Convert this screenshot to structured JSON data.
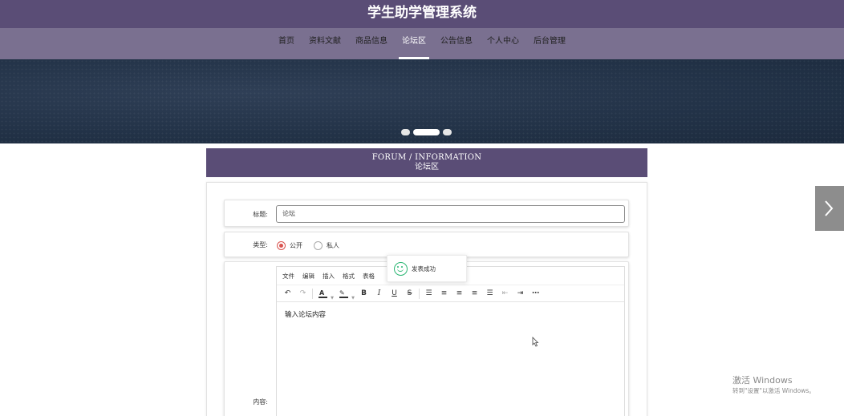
{
  "header": {
    "title": "学生助学管理系统"
  },
  "nav": {
    "items": [
      "首页",
      "资料文献",
      "商品信息",
      "论坛区",
      "公告信息",
      "个人中心",
      "后台管理"
    ],
    "active_index": 3
  },
  "banner": {
    "slides": 3,
    "active_slide": 1
  },
  "section": {
    "title_en": "FORUM / INFORMATION",
    "title_cn": "论坛区"
  },
  "form": {
    "title_label": "标题:",
    "title_value": "论坛",
    "type_label": "类型:",
    "type_options": [
      "公开",
      "私人"
    ],
    "type_selected": "公开",
    "content_label": "内容:"
  },
  "editor": {
    "menus": [
      "文件",
      "编辑",
      "插入",
      "格式",
      "表格"
    ],
    "placeholder": "输入论坛内容",
    "toolbar_icons": [
      "undo-icon",
      "redo-icon",
      "font-color-icon",
      "highlight-icon",
      "bold-icon",
      "italic-icon",
      "underline-icon",
      "strikethrough-icon",
      "line-height-icon",
      "align-left-icon",
      "align-center-icon",
      "align-right-icon",
      "justify-icon",
      "outdent-icon",
      "indent-icon",
      "more-icon"
    ]
  },
  "toast": {
    "message": "发表成功",
    "icon": "smile-icon",
    "color": "#2bb673"
  },
  "colors": {
    "primary": "#5a4d76",
    "nav": "#7a7090",
    "radio_accent": "#d9534f"
  },
  "watermark": {
    "line1": "激活 Windows",
    "line2": "转到\"设置\"以激活 Windows。"
  }
}
